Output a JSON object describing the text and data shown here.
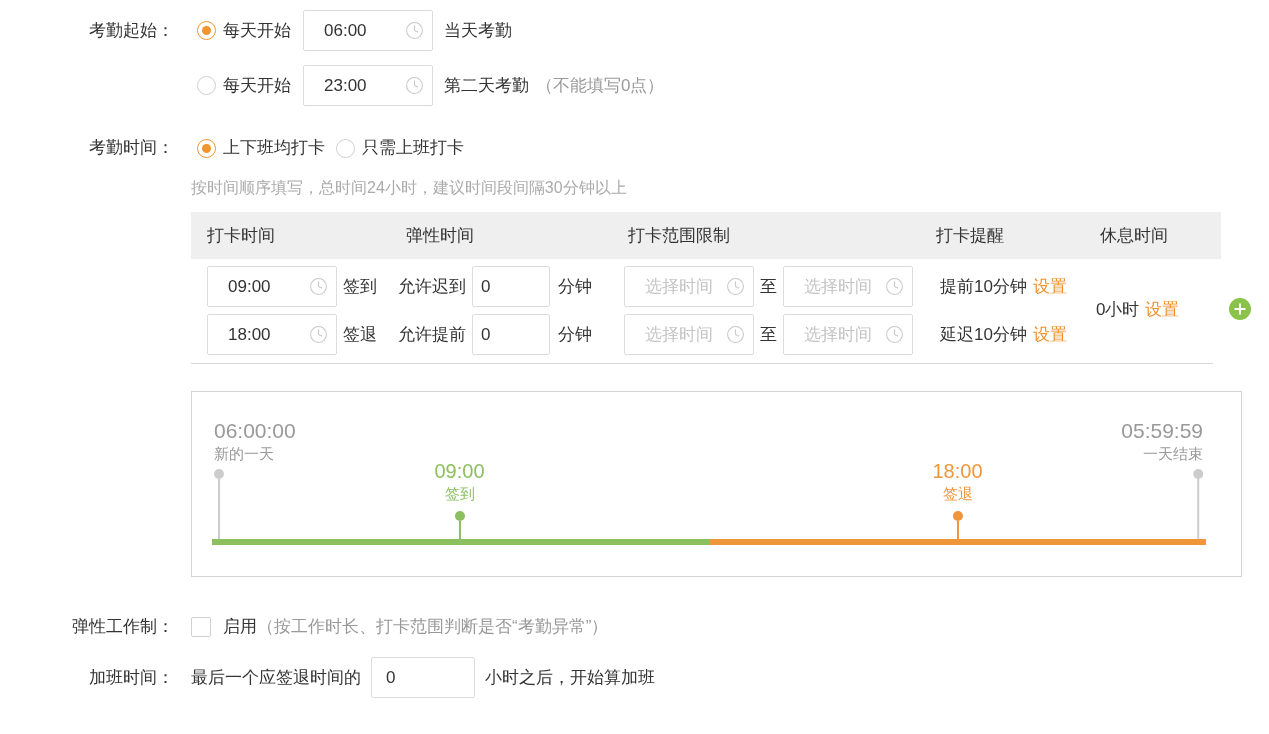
{
  "attendance_start": {
    "label": "考勤起始：",
    "options": [
      {
        "selected": true,
        "prefix": "每天开始",
        "time": "06:00",
        "suffix": "当天考勤"
      },
      {
        "selected": false,
        "prefix": "每天开始",
        "time": "23:00",
        "suffix": "第二天考勤",
        "note": "（不能填写0点）"
      }
    ]
  },
  "attendance_time": {
    "label": "考勤时间：",
    "options": [
      {
        "label": "上下班均打卡",
        "selected": true
      },
      {
        "label": "只需上班打卡",
        "selected": false
      }
    ],
    "hint": "按时间顺序填写，总时间24小时，建议时间段间隔30分钟以上"
  },
  "table": {
    "columns": [
      "打卡时间",
      "弹性时间",
      "打卡范围限制",
      "打卡提醒",
      "休息时间"
    ],
    "rows": [
      {
        "time": "09:00",
        "type": "签到",
        "flex_label": "允许迟到",
        "flex_value": "0",
        "flex_unit": "分钟",
        "range_from_placeholder": "选择时间",
        "range_sep": "至",
        "range_to_placeholder": "选择时间",
        "reminder": "提前10分钟",
        "reminder_link": "设置"
      },
      {
        "time": "18:00",
        "type": "签退",
        "flex_label": "允许提前",
        "flex_value": "0",
        "flex_unit": "分钟",
        "range_from_placeholder": "选择时间",
        "range_sep": "至",
        "range_to_placeholder": "选择时间",
        "reminder": "延迟10分钟",
        "reminder_link": "设置"
      }
    ],
    "rest": {
      "value": "0小时",
      "link": "设置"
    }
  },
  "timeline": {
    "markers": [
      {
        "kind": "start",
        "time": "06:00:00",
        "label": "新的一天",
        "color": "#cccccc"
      },
      {
        "kind": "checkin",
        "time": "09:00",
        "label": "签到",
        "color": "#8cbf5f"
      },
      {
        "kind": "checkout",
        "time": "18:00",
        "label": "签退",
        "color": "#f0963a"
      },
      {
        "kind": "end",
        "time": "05:59:59",
        "label": "一天结束",
        "color": "#cccccc"
      }
    ]
  },
  "flexible_work": {
    "label": "弹性工作制：",
    "checked": false,
    "text": "启用",
    "note": "（按工作时长、打卡范围判断是否“考勤异常”）"
  },
  "overtime": {
    "label": "加班时间：",
    "prefix": "最后一个应签退时间的",
    "value": "0",
    "suffix": "小时之后，开始算加班"
  }
}
